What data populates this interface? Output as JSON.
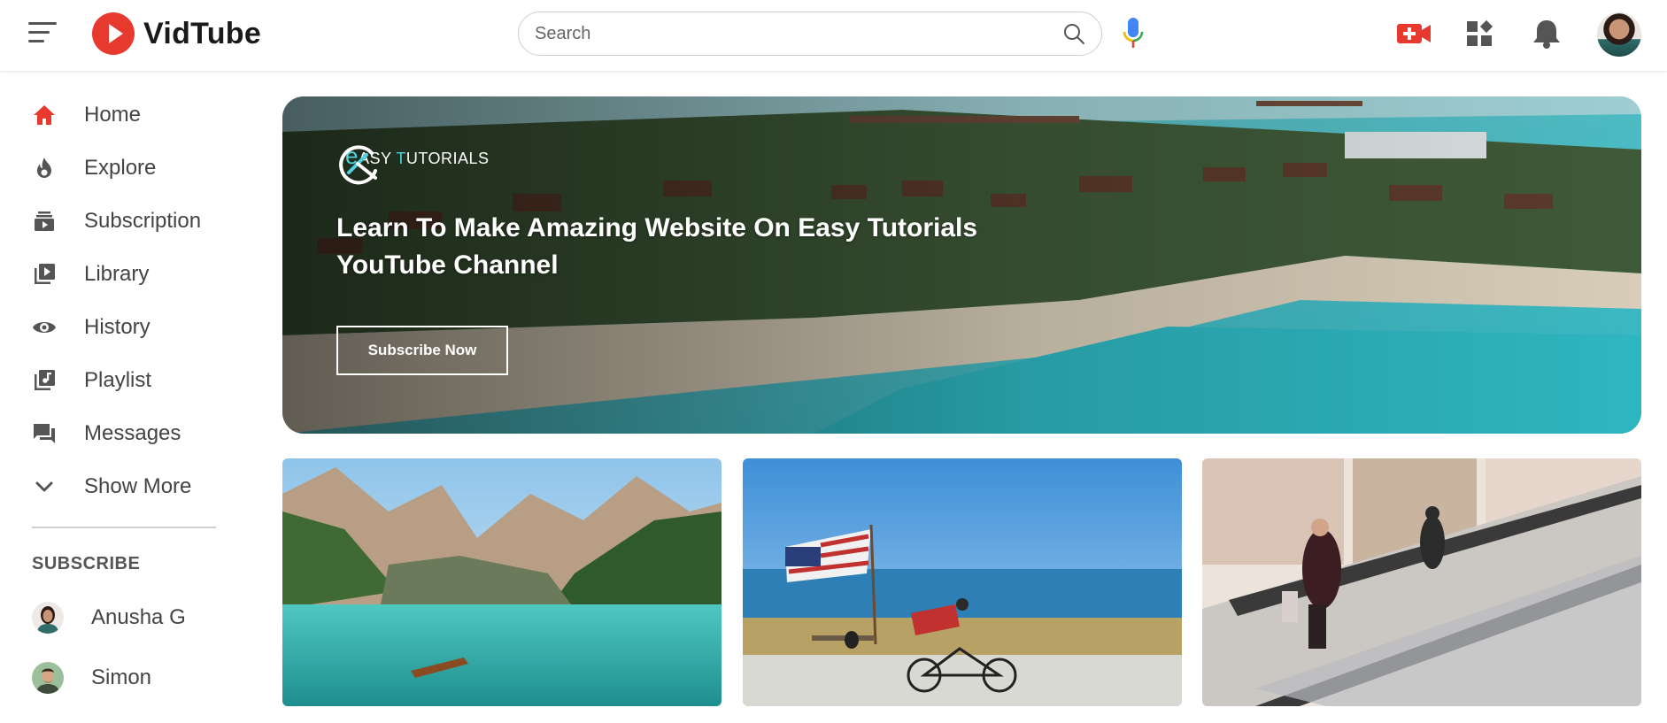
{
  "header": {
    "app_name": "VidTube",
    "search_placeholder": "Search"
  },
  "sidebar": {
    "items": [
      {
        "label": "Home",
        "icon": "home-icon"
      },
      {
        "label": "Explore",
        "icon": "flame-icon"
      },
      {
        "label": "Subscription",
        "icon": "subscription-icon"
      },
      {
        "label": "Library",
        "icon": "library-icon"
      },
      {
        "label": "History",
        "icon": "eye-icon"
      },
      {
        "label": "Playlist",
        "icon": "playlist-icon"
      },
      {
        "label": "Messages",
        "icon": "chat-icon"
      },
      {
        "label": "Show More",
        "icon": "chevron-down-icon"
      }
    ],
    "subscribe_title": "SUBSCRIBE",
    "subscriptions": [
      {
        "name": "Anusha G"
      },
      {
        "name": "Simon"
      }
    ]
  },
  "banner": {
    "brand_initial": "e",
    "brand_rest_1": "ASY ",
    "brand_t": "T",
    "brand_rest_2": "UTORIALS",
    "title": "Learn To Make Amazing Website On Easy Tutorials YouTube Channel",
    "button": "Subscribe Now"
  },
  "colors": {
    "brand_red": "#e8392f",
    "accent_teal": "#4fd1e0",
    "text_gray": "#444444"
  }
}
